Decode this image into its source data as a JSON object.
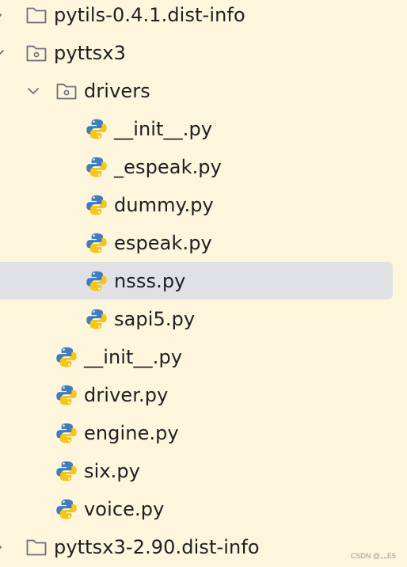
{
  "tree": {
    "items": [
      {
        "label": "pytils-0.4.1.dist-info",
        "type": "folder",
        "plain": true,
        "depth": 0,
        "expanded": false
      },
      {
        "label": "pyttsx3",
        "type": "folder",
        "plain": false,
        "depth": 0,
        "expanded": true
      },
      {
        "label": "drivers",
        "type": "folder",
        "plain": false,
        "depth": 1,
        "expanded": true
      },
      {
        "label": "__init__.py",
        "type": "python",
        "depth": 2
      },
      {
        "label": "_espeak.py",
        "type": "python",
        "depth": 2
      },
      {
        "label": "dummy.py",
        "type": "python",
        "depth": 2
      },
      {
        "label": "espeak.py",
        "type": "python",
        "depth": 2
      },
      {
        "label": "nsss.py",
        "type": "python",
        "depth": 2,
        "selected": true
      },
      {
        "label": "sapi5.py",
        "type": "python",
        "depth": 2
      },
      {
        "label": "__init__.py",
        "type": "python",
        "depth": 1
      },
      {
        "label": "driver.py",
        "type": "python",
        "depth": 1
      },
      {
        "label": "engine.py",
        "type": "python",
        "depth": 1
      },
      {
        "label": "six.py",
        "type": "python",
        "depth": 1
      },
      {
        "label": "voice.py",
        "type": "python",
        "depth": 1
      },
      {
        "label": "pyttsx3-2.90.dist-info",
        "type": "folder",
        "plain": true,
        "depth": 0,
        "expanded": false
      }
    ]
  },
  "watermark": "CSDN @灬E5",
  "colors": {
    "background": "#fdf5dc",
    "selection": "#dfe1e5",
    "python_blue": "#3f7cc0",
    "python_yellow": "#f5c518",
    "folder_stroke": "#6c707e"
  }
}
